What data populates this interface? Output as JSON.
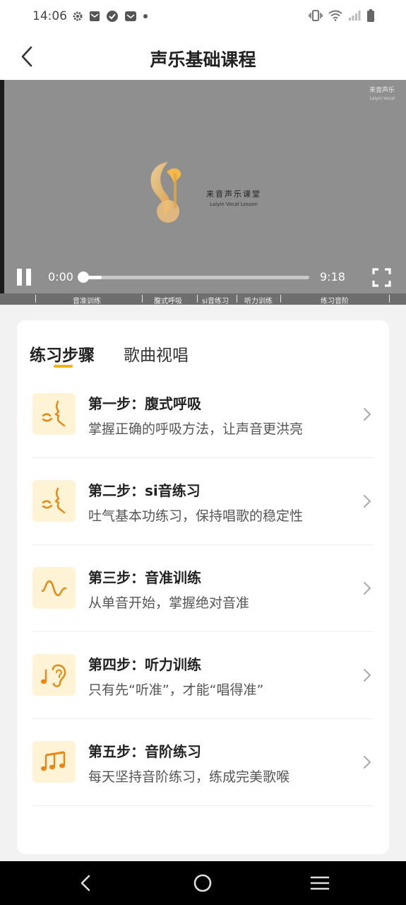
{
  "status_bar": {
    "time": "14:06",
    "left_icons": [
      "gear-icon",
      "mail-icon",
      "check-circle-icon",
      "message-icon",
      "dot-icon"
    ],
    "right_icons": [
      "vibrate-icon",
      "wifi-icon",
      "signal-icon",
      "battery-icon"
    ]
  },
  "header": {
    "title": "声乐基础课程",
    "back_icon": "chevron-left-icon"
  },
  "video": {
    "corner_logo": "来音声乐",
    "corner_logo_en": "Laiyin Vocal",
    "brand_cn": "来音声乐课堂",
    "brand_en": "Laiyin Vocal Lesson",
    "current_time": "0:00",
    "total_time": "9:18",
    "progress": 0.0,
    "chapters": [
      "音准训练",
      "腹式呼吸",
      "si音练习",
      "听力训练",
      "练习音阶"
    ]
  },
  "tabs": [
    {
      "label": "练习步骤",
      "active": true
    },
    {
      "label": "歌曲视唱",
      "active": false
    }
  ],
  "steps": [
    {
      "title": "第一步：腹式呼吸",
      "desc": "掌握正确的呼吸方法，让声音更洪亮",
      "icon": "breath-face-icon"
    },
    {
      "title": "第二步：si音练习",
      "desc": "吐气基本功练习，保持唱歌的稳定性",
      "icon": "breath-face-icon"
    },
    {
      "title": "第三步：音准训练",
      "desc": "从单音开始，掌握绝对音准",
      "icon": "sound-wave-icon"
    },
    {
      "title": "第四步：听力训练",
      "desc": "只有先“听准”，才能“唱得准”",
      "icon": "ear-note-icon"
    },
    {
      "title": "第五步：音阶练习",
      "desc": "每天坚持音阶练习，练成完美歌喉",
      "icon": "music-notes-icon"
    }
  ],
  "colors": {
    "accent": "#f5b300",
    "icon_orange": "#e8870f",
    "icon_bg": "#fff3d6"
  },
  "nav": [
    "back-icon",
    "home-icon",
    "menu-icon"
  ]
}
